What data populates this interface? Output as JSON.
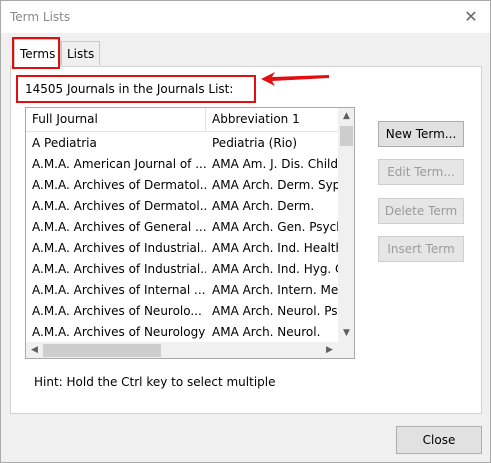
{
  "window": {
    "title": "Term Lists",
    "close_icon": "close-icon"
  },
  "tabs": [
    {
      "label": "Terms",
      "selected": true
    },
    {
      "label": "Lists",
      "selected": false
    }
  ],
  "count_label": "14505 Journals in the Journals List:",
  "list": {
    "columns": [
      "Full Journal",
      "Abbreviation 1"
    ],
    "rows": [
      [
        "A Pediatria",
        "Pediatria (Rio)"
      ],
      [
        "A.M.A. American Journal of ...",
        "AMA Am. J. Dis. Child"
      ],
      [
        "A.M.A. Archives of Dermatol...",
        "AMA Arch. Derm. Syp"
      ],
      [
        "A.M.A. Archives of Dermatol...",
        "AMA Arch. Derm."
      ],
      [
        "A.M.A. Archives of General ...",
        "AMA Arch. Gen. Psych"
      ],
      [
        "A.M.A. Archives of Industrial...",
        "AMA Arch. Ind. Health"
      ],
      [
        "A.M.A. Archives of Industrial...",
        "AMA Arch. Ind. Hyg. O"
      ],
      [
        "A.M.A. Archives of Internal ...",
        "AMA Arch. Intern. Me"
      ],
      [
        "A.M.A. Archives of Neurolo...",
        "AMA Arch. Neurol. Ps"
      ],
      [
        "A.M.A. Archives of Neurology",
        "AMA Arch. Neurol."
      ]
    ]
  },
  "buttons": {
    "new_term": "New Term...",
    "edit_term": "Edit Term...",
    "delete_term": "Delete Term",
    "insert_term": "Insert Term",
    "close": "Close"
  },
  "hint": "Hint: Hold the Ctrl key to select multiple",
  "colors": {
    "annotation_red": "#e01010"
  }
}
